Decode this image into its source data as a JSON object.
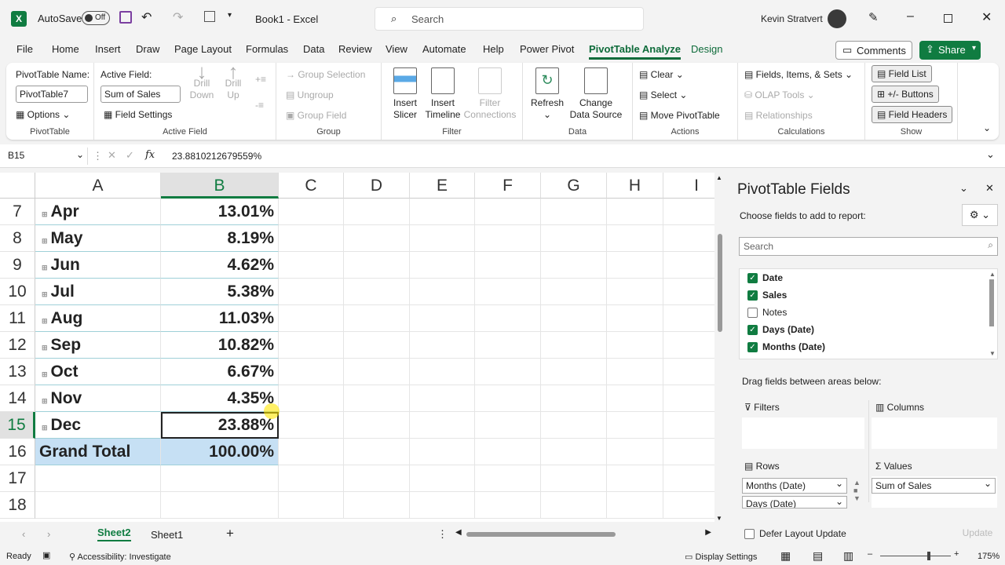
{
  "titlebar": {
    "autosave": "AutoSave",
    "toggle": "Off",
    "doc": "Book1  -  Excel",
    "search": "Search",
    "user": "Kevin Stratvert"
  },
  "menu": [
    "File",
    "Home",
    "Insert",
    "Draw",
    "Page Layout",
    "Formulas",
    "Data",
    "Review",
    "View",
    "Automate",
    "Help",
    "Power Pivot",
    "PivotTable Analyze",
    "Design"
  ],
  "menu_right": {
    "comments": "Comments",
    "share": "Share"
  },
  "ribbon": {
    "pivottable": {
      "name_label": "PivotTable Name:",
      "name_value": "PivotTable7",
      "options": "Options",
      "group": "PivotTable"
    },
    "active_field": {
      "label": "Active Field:",
      "value": "Sum of Sales",
      "field_settings": "Field Settings",
      "drill_down": "Drill Down",
      "drill_up": "Drill Up",
      "group": "Active Field"
    },
    "group": {
      "group_selection": "Group Selection",
      "ungroup": "Ungroup",
      "group_field": "Group Field",
      "group": "Group"
    },
    "filter": {
      "insert_slicer": "Insert Slicer",
      "insert_timeline": "Insert Timeline",
      "filter_connections": "Filter Connections",
      "group": "Filter"
    },
    "data": {
      "refresh": "Refresh",
      "change_source": "Change Data Source",
      "group": "Data"
    },
    "actions": {
      "clear": "Clear",
      "select": "Select",
      "move": "Move PivotTable",
      "group": "Actions"
    },
    "calculations": {
      "fields": "Fields, Items, & Sets",
      "olap": "OLAP Tools",
      "relationships": "Relationships",
      "group": "Calculations"
    },
    "show": {
      "field_list": "Field List",
      "buttons": "+/- Buttons",
      "field_headers": "Field Headers",
      "group": "Show"
    }
  },
  "formula_bar": {
    "name_box": "B15",
    "fx": "fx",
    "formula": "23.8810212679559%"
  },
  "columns": [
    "A",
    "B",
    "C",
    "D",
    "E",
    "F",
    "G",
    "H",
    "I"
  ],
  "rows": [
    {
      "num": "7",
      "label": "Apr",
      "value": "13.01%"
    },
    {
      "num": "8",
      "label": "May",
      "value": "8.19%"
    },
    {
      "num": "9",
      "label": "Jun",
      "value": "4.62%"
    },
    {
      "num": "10",
      "label": "Jul",
      "value": "5.38%"
    },
    {
      "num": "11",
      "label": "Aug",
      "value": "11.03%"
    },
    {
      "num": "12",
      "label": "Sep",
      "value": "10.82%"
    },
    {
      "num": "13",
      "label": "Oct",
      "value": "6.67%"
    },
    {
      "num": "14",
      "label": "Nov",
      "value": "4.35%"
    },
    {
      "num": "15",
      "label": "Dec",
      "value": "23.88%"
    },
    {
      "num": "16",
      "label": "Grand Total",
      "value": "100.00%"
    },
    {
      "num": "17",
      "label": "",
      "value": ""
    },
    {
      "num": "18",
      "label": "",
      "value": ""
    }
  ],
  "sheet_tabs": [
    "Sheet2",
    "Sheet1"
  ],
  "panel": {
    "title": "PivotTable Fields",
    "subtitle": "Choose fields to add to report:",
    "search_placeholder": "Search",
    "fields": [
      {
        "name": "Date",
        "checked": true
      },
      {
        "name": "Sales",
        "checked": true
      },
      {
        "name": "Notes",
        "checked": false
      },
      {
        "name": "Days (Date)",
        "checked": true
      },
      {
        "name": "Months (Date)",
        "checked": true
      }
    ],
    "drag_text": "Drag fields between areas below:",
    "filters": "Filters",
    "columns": "Columns",
    "rows": "Rows",
    "values": "Values",
    "rows_items": [
      "Months (Date)",
      "Days (Date)"
    ],
    "values_items": [
      "Sum of Sales"
    ],
    "defer": "Defer Layout Update",
    "update": "Update"
  },
  "status": {
    "ready": "Ready",
    "accessibility": "Accessibility: Investigate",
    "display": "Display Settings",
    "zoom": "175%"
  },
  "colors": {
    "accent": "#107c41",
    "total_fill": "#c6e0f4"
  }
}
